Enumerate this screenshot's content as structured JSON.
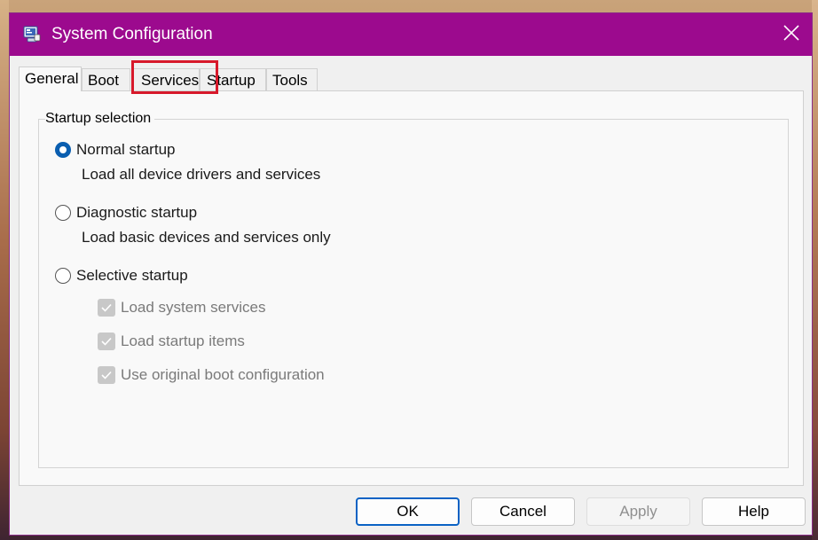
{
  "window": {
    "title": "System Configuration",
    "title_bar_color": "#9c0a8e",
    "icon": "msconfig-app-icon",
    "close_icon": "close-icon"
  },
  "tabs": [
    {
      "label": "General",
      "active": true
    },
    {
      "label": "Boot",
      "active": false
    },
    {
      "label": "Services",
      "active": false,
      "highlighted": true
    },
    {
      "label": "Startup",
      "active": false
    },
    {
      "label": "Tools",
      "active": false
    }
  ],
  "highlight_color": "#d7192b",
  "general": {
    "group_title": "Startup selection",
    "options": [
      {
        "label": "Normal startup",
        "description": "Load all device drivers and services",
        "selected": true
      },
      {
        "label": "Diagnostic startup",
        "description": "Load basic devices and services only",
        "selected": false
      },
      {
        "label": "Selective startup",
        "selected": false
      }
    ],
    "selective_options": [
      {
        "label": "Load system services",
        "checked": true,
        "enabled": false
      },
      {
        "label": "Load startup items",
        "checked": true,
        "enabled": false
      },
      {
        "label": "Use original boot configuration",
        "checked": true,
        "enabled": false
      }
    ]
  },
  "buttons": {
    "ok": "OK",
    "cancel": "Cancel",
    "apply": "Apply",
    "help": "Help"
  },
  "accent_color": "#0a5eb0"
}
